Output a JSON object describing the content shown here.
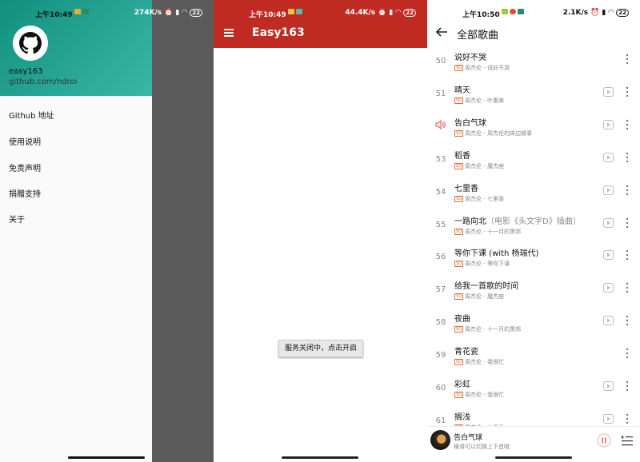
{
  "screens": {
    "drawer": {
      "status_time": "上午10:49",
      "status_speed": "274K/s",
      "status_battery": "22",
      "profile_name": "easy163",
      "profile_link": "github.com/ndroi",
      "menu": [
        {
          "label": "Github 地址"
        },
        {
          "label": "使用说明"
        },
        {
          "label": "免责声明"
        },
        {
          "label": "捐赠支持"
        },
        {
          "label": "关于"
        }
      ]
    },
    "main": {
      "status_time": "上午10:49",
      "status_speed": "44.4K/s",
      "status_battery": "22",
      "app_title": "Easy163",
      "service_button": "服务关闭中，点击开启",
      "accent_color": "#bf2a22"
    },
    "songs": {
      "status_time": "上午10:50",
      "status_speed": "2.1K/s",
      "status_battery": "22",
      "title": "全部歌曲",
      "quality_badge": "SQ",
      "items": [
        {
          "num": "50",
          "title": "说好不哭",
          "extra": "",
          "sub": "周杰伦 - 说好不哭",
          "mv": false
        },
        {
          "num": "51",
          "title": "晴天",
          "extra": "",
          "sub": "周杰伦 - 叶惠美",
          "mv": true
        },
        {
          "num": "",
          "title": "告白气球",
          "extra": "",
          "sub": "周杰伦 - 周杰伦的床边故事",
          "mv": true,
          "playing": true
        },
        {
          "num": "53",
          "title": "稻香",
          "extra": "",
          "sub": "周杰伦 - 魔杰座",
          "mv": true
        },
        {
          "num": "54",
          "title": "七里香",
          "extra": "",
          "sub": "周杰伦 - 七里香",
          "mv": true
        },
        {
          "num": "55",
          "title": "一路向北",
          "extra": "（电影《头文字D》插曲）",
          "sub": "周杰伦 - 十一月的萧邦",
          "mv": true
        },
        {
          "num": "56",
          "title": "等你下课 (with 杨瑞代)",
          "extra": "",
          "sub": "周杰伦 - 等你下课",
          "mv": true
        },
        {
          "num": "57",
          "title": "给我一首歌的时间",
          "extra": "",
          "sub": "周杰伦 - 魔杰座",
          "mv": true
        },
        {
          "num": "58",
          "title": "夜曲",
          "extra": "",
          "sub": "周杰伦 - 十一月的萧邦",
          "mv": true
        },
        {
          "num": "59",
          "title": "青花瓷",
          "extra": "",
          "sub": "周杰伦 - 我很忙",
          "mv": false
        },
        {
          "num": "60",
          "title": "彩虹",
          "extra": "",
          "sub": "周杰伦 - 我很忙",
          "mv": true
        },
        {
          "num": "61",
          "title": "搁浅",
          "extra": "",
          "sub": "周杰伦 - 七里香",
          "mv": true
        }
      ],
      "player": {
        "title": "告白气球",
        "hint": "横滑可以切换上下首哦"
      }
    }
  }
}
